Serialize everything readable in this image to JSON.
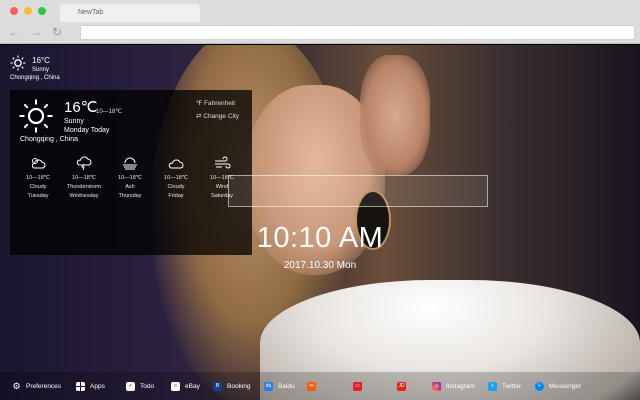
{
  "browser": {
    "tab_title": "NewTab",
    "url": ""
  },
  "weather_small": {
    "temp": "16°C",
    "condition": "Sunny",
    "location": "Chongqing , China"
  },
  "weather_panel": {
    "temp": "16℃",
    "range": "10—18℃",
    "condition": "Sunny",
    "day": "Monday Today",
    "location": "Chongqing , China",
    "fahrenheit_label": "℉ Fahrenheit",
    "change_city_label": "⇄ Change City",
    "forecast": [
      {
        "range": "10—18℃",
        "condition": "Cloudy",
        "day": "Tuesday",
        "icon": "partly-cloudy-icon"
      },
      {
        "range": "10—18℃",
        "condition": "Thunderstorm",
        "day": "Wednesday",
        "icon": "thunderstorm-icon"
      },
      {
        "range": "10—18℃",
        "condition": "Ash",
        "day": "Thursday",
        "icon": "haze-icon"
      },
      {
        "range": "10—18℃",
        "condition": "Cloudy",
        "day": "Friday",
        "icon": "cloud-icon"
      },
      {
        "range": "10—18℃",
        "condition": "Wind",
        "day": "Saturday",
        "icon": "wind-icon"
      }
    ]
  },
  "search": {
    "placeholder": ""
  },
  "clock": {
    "time": "10:10 AM",
    "date": "2017.10.30 Mon"
  },
  "bottom_bar": {
    "items": [
      {
        "label": "Preferences",
        "icon": "gear-icon",
        "color": "#ffffff"
      },
      {
        "label": "Apps",
        "icon": "apps-grid-icon",
        "color": "#ffffff"
      },
      {
        "label": "Todo",
        "icon": "checkbox-icon",
        "color": "#ffffff"
      },
      {
        "label": "eBay",
        "icon": "ebay-icon",
        "color": "#ffffff"
      },
      {
        "label": "Booking",
        "icon": "booking-icon",
        "color": "#1a3f8f"
      },
      {
        "label": "Baidu",
        "icon": "baidu-icon",
        "color": "#2d7ff0"
      },
      {
        "label": "",
        "icon": "orange-app-icon",
        "color": "#ff5a00"
      },
      {
        "label": "",
        "icon": "red-app-icon",
        "color": "#e8182e"
      },
      {
        "label": "",
        "icon": "jd-icon",
        "color": "#e1251b"
      },
      {
        "label": "Instagram",
        "icon": "instagram-icon",
        "color": "#d6307a"
      },
      {
        "label": "Twitter",
        "icon": "twitter-icon",
        "color": "#1da1f2"
      },
      {
        "label": "Messenger",
        "icon": "messenger-icon",
        "color": "#0084ff"
      }
    ]
  }
}
